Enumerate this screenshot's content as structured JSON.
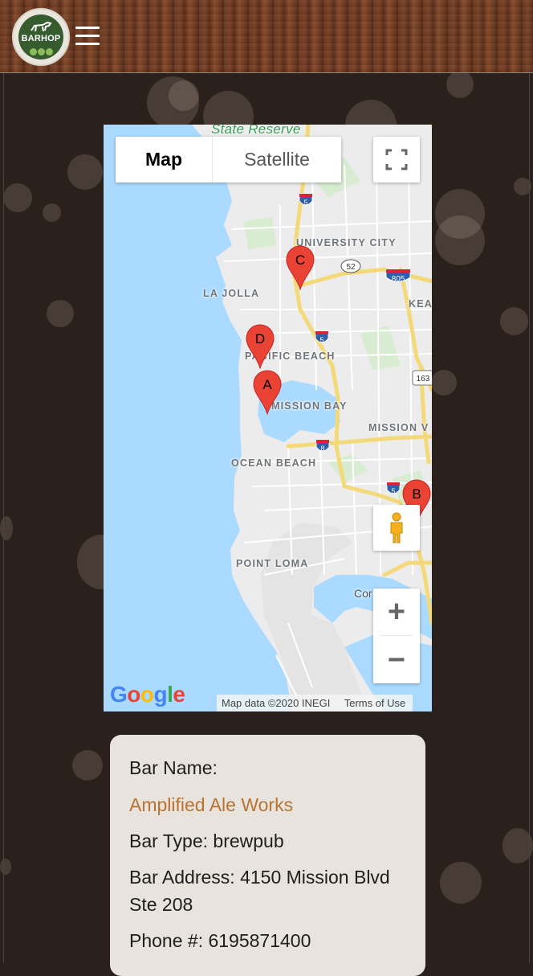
{
  "header": {
    "logo_text": "BARHOP"
  },
  "map": {
    "type_map_label": "Map",
    "type_satellite_label": "Satellite",
    "labels": [
      "State Reserve",
      "UNIVERSITY CITY",
      "LA JOLLA",
      "PACIFIC BEACH",
      "MISSION BAY",
      "MISSION V",
      "OCEAN BEACH",
      "POINT LOMA",
      "KEA",
      "Cor"
    ],
    "highway_shields": [
      "5",
      "52",
      "805",
      "5",
      "163",
      "8",
      "5"
    ],
    "markers": [
      "A",
      "B",
      "C",
      "D"
    ],
    "google_logo": "Google",
    "attribution": "Map data ©2020 INEGI",
    "terms": "Terms of Use"
  },
  "info": {
    "bar_name_label": "Bar Name:",
    "bar_name_value": "Amplified Ale Works",
    "bar_type": "Bar Type: brewpub",
    "bar_address": "Bar Address: 4150 Mission Blvd Ste 208",
    "phone": "Phone #: 6195871400"
  },
  "colors": {
    "accent_link": "#b87333",
    "marker": "#ea4335",
    "background": "#2a211c"
  }
}
